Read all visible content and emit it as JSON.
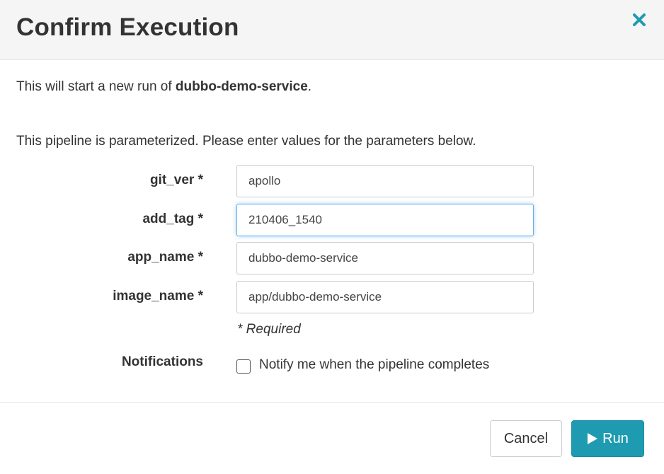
{
  "dialog": {
    "title": "Confirm Execution",
    "close_icon": "close-icon"
  },
  "intro": {
    "prefix": "This will start a new run of ",
    "pipeline_name": "dubbo-demo-service",
    "suffix": "."
  },
  "param_note": "This pipeline is parameterized. Please enter values for the parameters below.",
  "parameters": [
    {
      "label": "git_ver *",
      "value": "apollo"
    },
    {
      "label": "add_tag *",
      "value": "210406_1540"
    },
    {
      "label": "app_name *",
      "value": "dubbo-demo-service"
    },
    {
      "label": "image_name *",
      "value": "app/dubbo-demo-service"
    }
  ],
  "required_note": "* Required",
  "notifications": {
    "label": "Notifications",
    "checkbox_text": "Notify me when the pipeline completes",
    "checked": false
  },
  "footer": {
    "cancel_label": "Cancel",
    "run_label": "Run",
    "run_icon": "play-icon"
  },
  "colors": {
    "accent": "#1e9bb0",
    "close_icon": "#1e9bb0",
    "focus_border": "#66afe9"
  }
}
